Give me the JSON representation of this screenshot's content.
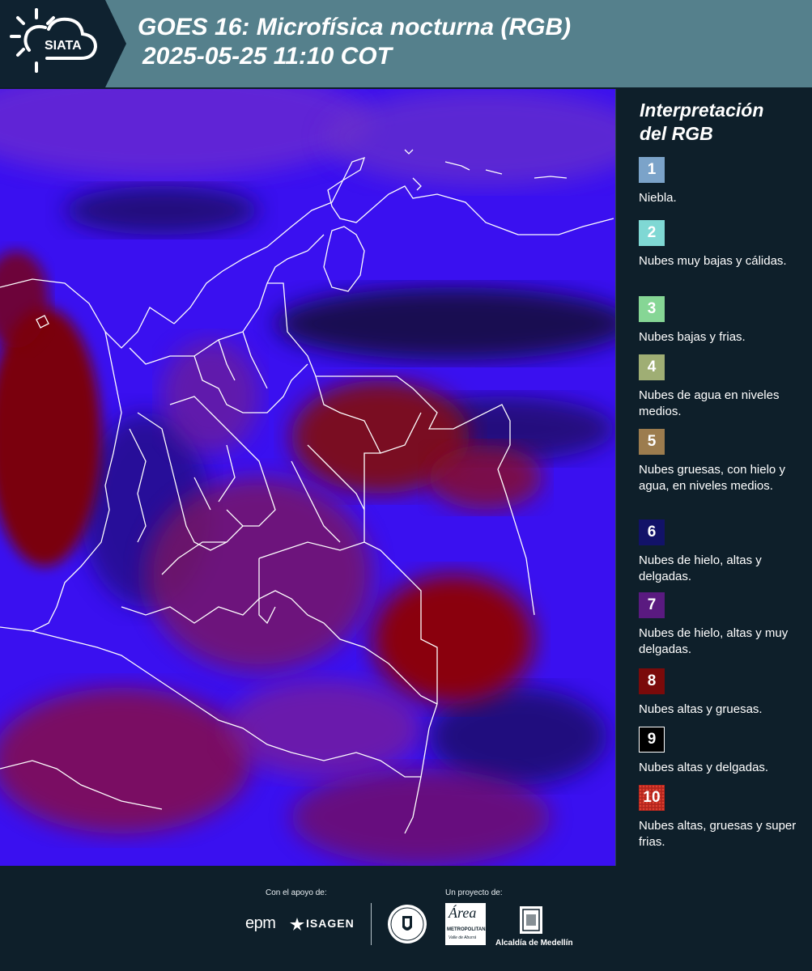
{
  "header": {
    "logo_text": "SIATA",
    "title_line1": "GOES 16: Microfísica nocturna (RGB)",
    "title_line2": "2025-05-25 11:10 COT"
  },
  "map": {
    "description_icon": "satellite-rgb-image",
    "colors": {
      "background": "#3300ff",
      "dark_blue": "#101040",
      "dark_red": "#7a0010",
      "magenta": "#8a1a8a",
      "border_line": "#ffffff"
    }
  },
  "legend": {
    "title_line1": "Interpretación",
    "title_line2": "del RGB",
    "items": [
      {
        "num": "1",
        "label": "Niebla.",
        "color": "#7ba3c9"
      },
      {
        "num": "2",
        "label": "Nubes muy bajas y cálidas.",
        "color": "#7fd8d4"
      },
      {
        "num": "3",
        "label": "Nubes bajas y frias.",
        "color": "#86d695"
      },
      {
        "num": "4",
        "label": "Nubes de agua en niveles medios.",
        "color": "#9fae74"
      },
      {
        "num": "5",
        "label": "Nubes gruesas, con hielo y agua, en niveles medios.",
        "color": "#9c7c4e"
      },
      {
        "num": "6",
        "label": "Nubes de hielo, altas y delgadas.",
        "color": "#121268"
      },
      {
        "num": "7",
        "label": "Nubes de hielo, altas y muy delgadas.",
        "color": "#5a1a80"
      },
      {
        "num": "8",
        "label": "Nubes altas y gruesas.",
        "color": "#7a0a0a"
      },
      {
        "num": "9",
        "label": "Nubes altas y delgadas.",
        "color": "#000000"
      },
      {
        "num": "10",
        "label": "Nubes altas, gruesas y super frias.",
        "color": "#b3261e"
      }
    ]
  },
  "footer": {
    "support_caption": "Con el apoyo de:",
    "project_caption": "Un proyecto de:",
    "logos": {
      "epm": "epm",
      "isagen": "ISAGEN",
      "area": "Área",
      "area_sub1": "METROPOLITANA",
      "area_sub2": "Valle de Aburrá",
      "alcaldia": "Alcaldía de Medellín"
    }
  }
}
